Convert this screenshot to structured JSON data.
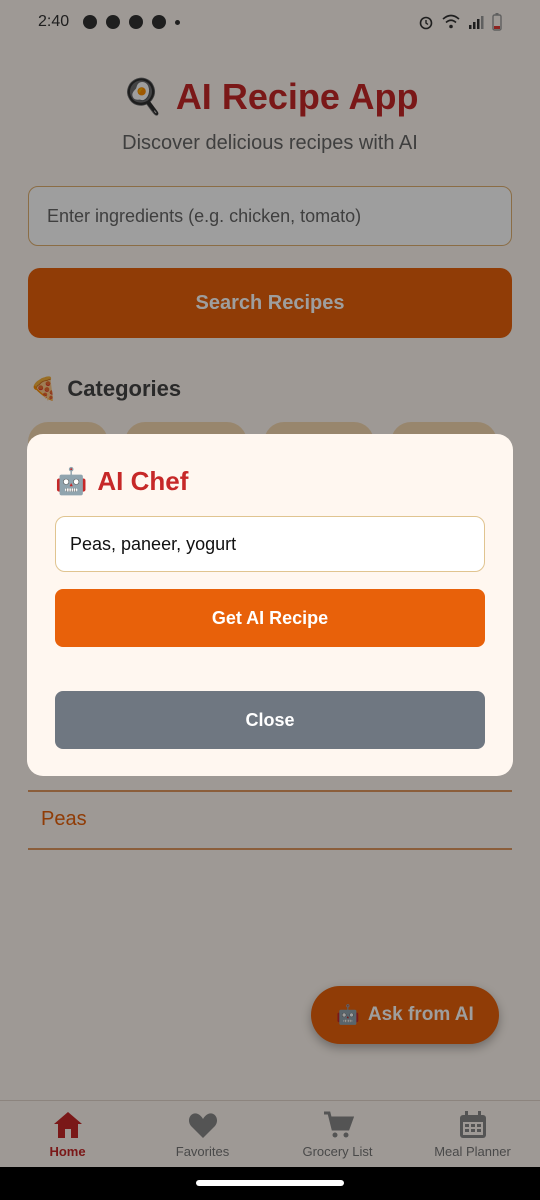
{
  "status_bar": {
    "time": "2:40"
  },
  "app": {
    "title_emoji": "🍳",
    "title": "AI Recipe App",
    "subtitle": "Discover delicious recipes with AI"
  },
  "search": {
    "placeholder": "Enter ingredients (e.g. chicken, tomato)",
    "button_label": "Search Recipes"
  },
  "categories": {
    "emoji": "🍕",
    "title": "Categories"
  },
  "results": {
    "items": [
      {
        "label": "Peas"
      }
    ]
  },
  "fab": {
    "emoji": "🤖",
    "label": "Ask from AI"
  },
  "modal": {
    "emoji": "🤖",
    "title": "AI Chef",
    "input_value": "Peas, paneer, yogurt",
    "primary_button": "Get AI Recipe",
    "secondary_button": "Close"
  },
  "bottom_nav": {
    "items": [
      {
        "label": "Home",
        "icon": "home-icon",
        "active": true
      },
      {
        "label": "Favorites",
        "icon": "heart-icon",
        "active": false
      },
      {
        "label": "Grocery List",
        "icon": "cart-icon",
        "active": false
      },
      {
        "label": "Meal Planner",
        "icon": "calendar-icon",
        "active": false
      }
    ]
  },
  "colors": {
    "accent": "#e8610a",
    "title_red": "#c62828",
    "close_gray": "#6f7781",
    "background": "#fff7f0"
  }
}
